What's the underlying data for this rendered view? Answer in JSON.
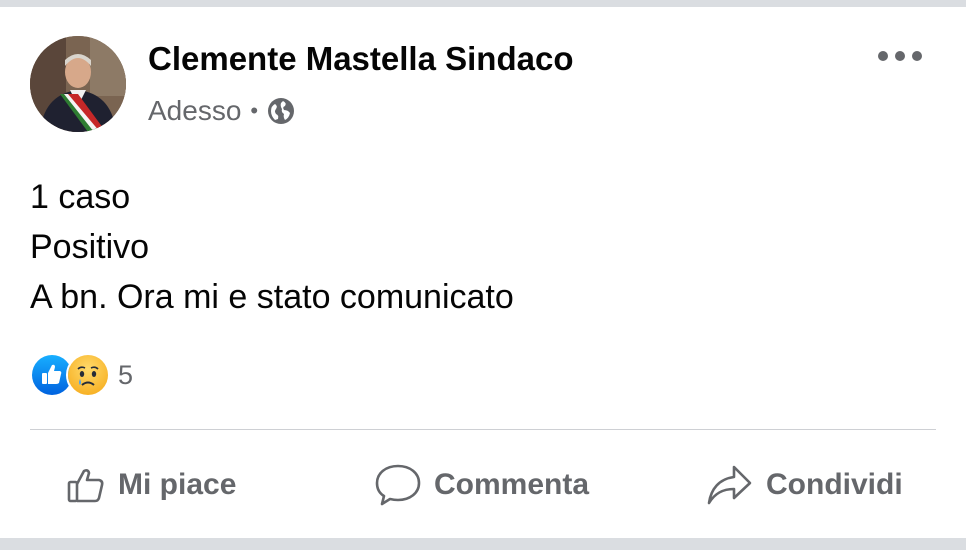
{
  "post": {
    "author": "Clemente Mastella Sindaco",
    "timestamp": "Adesso",
    "separator": "•",
    "privacy_icon": "globe-icon",
    "more_icon": "more-options-icon",
    "lines": [
      "1 caso",
      "Positivo",
      "A bn. Ora mi e stato comunicato"
    ]
  },
  "reactions": {
    "icons": [
      "like-reaction-icon",
      "sad-reaction-icon"
    ],
    "count": "5"
  },
  "actions": {
    "like_label": "Mi piace",
    "comment_label": "Commenta",
    "share_label": "Condividi"
  },
  "colors": {
    "primary_text": "#050505",
    "secondary_text": "#65676b",
    "like_blue": "#1877f2",
    "sad_yellow": "#f7b125",
    "divider": "#ced0d4",
    "page_band": "#dadde1"
  }
}
